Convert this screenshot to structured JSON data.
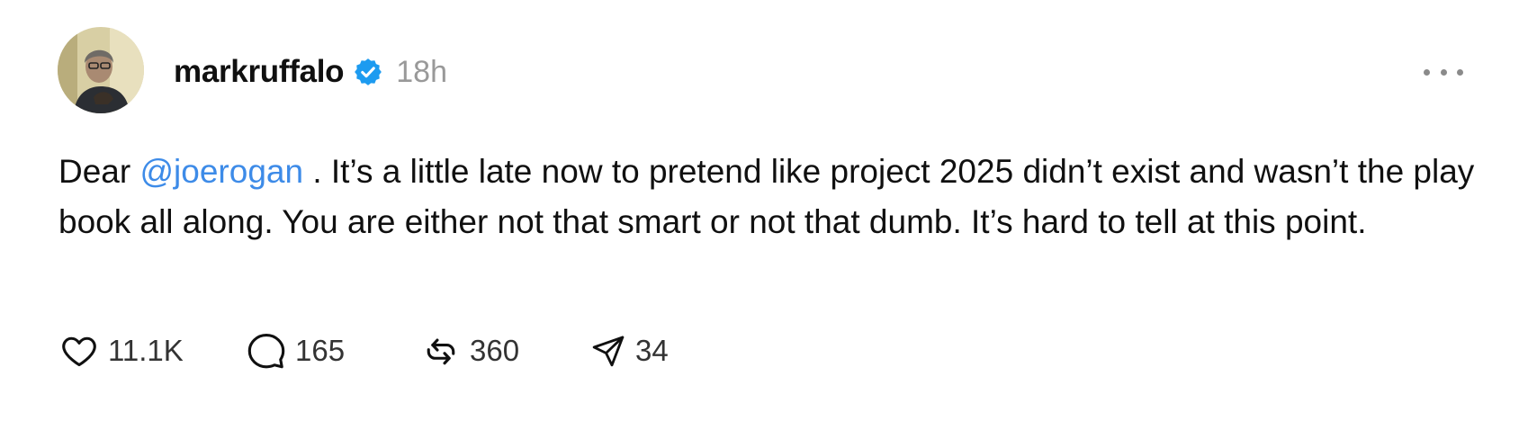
{
  "post": {
    "username": "markruffalo",
    "verified": true,
    "timestamp": "18h",
    "text": {
      "prefix": "Dear ",
      "mention": "@joerogan",
      "rest": " . It’s a little late now to pretend like project 2025 didn’t exist and wasn’t the play book all along. You are either not that smart or not that dumb. It’s hard to tell at this point."
    },
    "actions": {
      "likes": "11.1K",
      "replies": "165",
      "reposts": "360",
      "shares": "34"
    }
  },
  "colors": {
    "verified_badge": "#1d9bf0",
    "mention": "#3d8be8",
    "timestamp": "#999999"
  },
  "icons": {
    "avatar": "profile-photo",
    "verified": "verified-badge-icon",
    "more": "more-horizontal-icon",
    "like": "heart-icon",
    "reply": "speech-bubble-icon",
    "repost": "repost-arrows-icon",
    "share": "send-plane-icon"
  }
}
